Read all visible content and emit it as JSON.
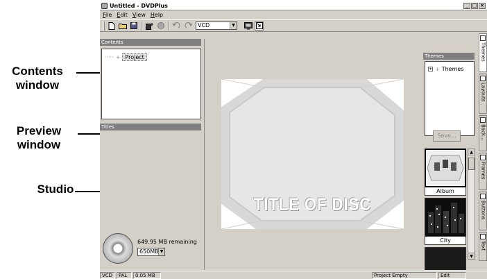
{
  "annotations": {
    "contents_window": [
      "Contents",
      "window"
    ],
    "preview_window": [
      "Preview",
      "window"
    ],
    "studio": "Studio"
  },
  "window": {
    "title": "Untitled - DVDPlus",
    "buttons": [
      "_",
      "□",
      "×"
    ]
  },
  "menu": {
    "items": [
      "File",
      "Edit",
      "View",
      "Help"
    ]
  },
  "toolbar": {
    "icons": [
      "new-icon",
      "open-icon",
      "save-icon",
      "add-title-icon",
      "record-icon",
      "undo-icon",
      "redo-icon",
      "view-mode-icon",
      "fit-icon"
    ],
    "format_select": "VCD"
  },
  "contents_panel": {
    "header": "Contents",
    "tree_item": "Project"
  },
  "titles_panel": {
    "header": "Titles"
  },
  "disc": {
    "remaining": "649.95 MB remaining",
    "size_select": "650MB"
  },
  "preview": {
    "title_text": "TITLE OF DISC"
  },
  "themes_panel": {
    "header": "Themes",
    "tree_item": "Themes"
  },
  "save_button": "Save...",
  "thumbnails": [
    {
      "caption": "Album"
    },
    {
      "caption": "City"
    }
  ],
  "side_tabs": [
    "Themes",
    "Layouts",
    "Back...",
    "Frames",
    "Buttons",
    "Text"
  ],
  "status": {
    "format": "VCD",
    "standard": "PAL",
    "size": "0.05 MB",
    "message": "Project Empty",
    "mode": "Edit"
  },
  "colors": {
    "chrome": "#d4d0c8",
    "panel_header": "#808080",
    "preview_bg": "#e4e4e4"
  }
}
